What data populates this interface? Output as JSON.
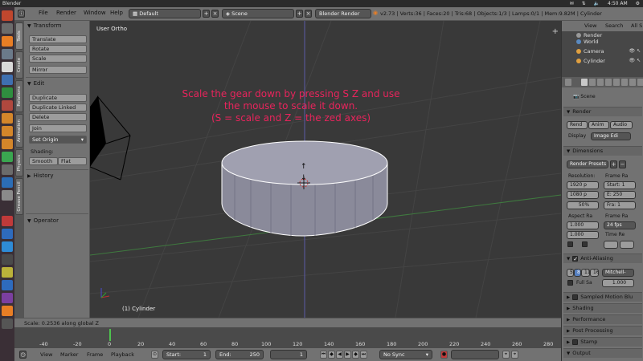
{
  "ubuntu_bar": {
    "app_title": "Blender",
    "clock": "4:50 AM"
  },
  "info_header": {
    "menus": [
      "File",
      "Render",
      "Window",
      "Help"
    ],
    "layout": "Default",
    "scene": "Scene",
    "engine": "Blender Render",
    "stats": "v2.73 | Verts:36 | Faces:20 | Tris:68 | Objects:1/3 | Lamps:0/1 | Mem:9.82M | Cylinder"
  },
  "tool_tabs": [
    "Tools",
    "Create",
    "Relations",
    "Animation",
    "Physics",
    "Grease Pencil"
  ],
  "tool_shelf": {
    "transform_header": "Transform",
    "transform_buttons": [
      "Translate",
      "Rotate",
      "Scale"
    ],
    "mirror": "Mirror",
    "edit_header": "Edit",
    "edit_buttons": [
      "Duplicate",
      "Duplicate Linked",
      "Delete"
    ],
    "join": "Join",
    "set_origin": "Set Origin",
    "shading_label": "Shading:",
    "smooth": "Smooth",
    "flat": "Flat",
    "history_header": "History",
    "operator_header": "Operator"
  },
  "viewport": {
    "view_label": "User Ortho",
    "object_label": "(1) Cylinder",
    "instruction_lines": [
      "Scale the gear down by pressing S Z and use",
      "the mouse to scale it down.",
      "(S = scale and Z = the zed axes)"
    ],
    "colors": {
      "background": "#393939",
      "grid": "#4a4a4a",
      "x_axis": "#3f7a3f",
      "z_axis": "#5a5aa8",
      "instruction": "#e8245c"
    }
  },
  "status_line": "Scale: 0.2536 along global Z",
  "timeline": {
    "ticks": [
      "-40",
      "-20",
      "0",
      "20",
      "40",
      "60",
      "80",
      "100",
      "120",
      "140",
      "160",
      "180",
      "200",
      "220",
      "240",
      "260",
      "280"
    ],
    "current_frame_marker": 1,
    "menus": [
      "View",
      "Marker",
      "Frame",
      "Playback"
    ],
    "start_label": "Start:",
    "start_value": "1",
    "end_label": "End:",
    "end_value": "250",
    "current_frame": "1",
    "sync": "No Sync"
  },
  "outliner": {
    "view_btn": "View",
    "search_btn": "Search",
    "all_btn": "All S",
    "rows": [
      "Render",
      "World",
      "Camera",
      "Cylinder"
    ]
  },
  "properties": {
    "scene_label": "Scene",
    "render_header": "Render",
    "render_btn": "Rend",
    "anim_btn": "Anim",
    "audio_btn": "Audio",
    "display_label": "Display",
    "display_value": "Image Edi",
    "dimensions_header": "Dimensions",
    "render_presets": "Render Presets",
    "resolution_label": "Resolution:",
    "frame_range_label": "Frame Ra",
    "res_x": "1920 p",
    "res_y": "1080 p",
    "res_pct": "50%",
    "start": "Start: 1",
    "end": "E: 250",
    "frame": "Fra: 1",
    "aspect_label": "Aspect Ra",
    "frame_rate_label": "Frame Ra",
    "aspect_x": "1.000",
    "aspect_y": "1.000",
    "fps": "24 fps",
    "time_remap_label": "Time Re",
    "anti_aliasing": "Anti-Aliasing",
    "aa_samples": [
      "5",
      "8",
      "11",
      "16"
    ],
    "aa_filter": "Mitchell-",
    "full_sample": "Full Sa",
    "filter_size": "1.000",
    "sampled_motion": "Sampled Motion Blu",
    "shading": "Shading",
    "performance": "Performance",
    "post_processing": "Post Processing",
    "stamp": "Stamp",
    "output": "Output"
  }
}
